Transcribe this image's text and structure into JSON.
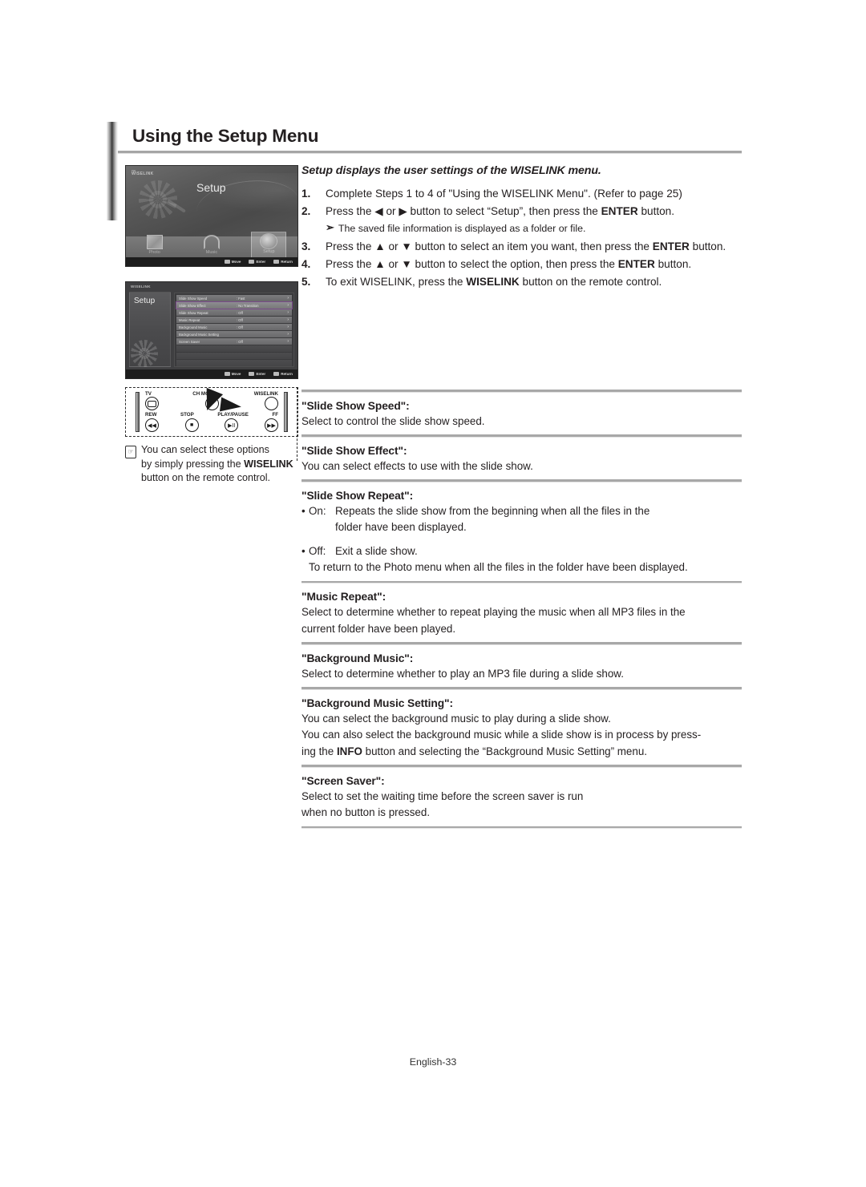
{
  "page": {
    "title": "Using the Setup Menu",
    "footer": "English-33"
  },
  "tv_screen_1": {
    "logo": "WISELINK",
    "logo_tm": "TM",
    "heading": "Setup",
    "icons": [
      {
        "label": "Photo",
        "selected": false
      },
      {
        "label": "Music",
        "selected": false
      },
      {
        "label": "Setup",
        "selected": true
      }
    ],
    "hints": [
      {
        "key": "◀▶",
        "label": "Move"
      },
      {
        "key": "ENTER",
        "label": "Enter"
      },
      {
        "key": "RETURN",
        "label": "Return"
      }
    ]
  },
  "tv_screen_2": {
    "logo": "WISELINK",
    "panel_title": "Setup",
    "rows": [
      {
        "name": "Slide Show Speed",
        "value": ": Fast",
        "highlight": false
      },
      {
        "name": "Slide Show Effect",
        "value": ": No Transition",
        "highlight": true
      },
      {
        "name": "Slide Show Repeat",
        "value": ": Off",
        "highlight": false
      },
      {
        "name": "Music Repeat",
        "value": ": Off",
        "highlight": false
      },
      {
        "name": "Background Music",
        "value": ": Off",
        "highlight": false
      },
      {
        "name": "Background Music Setting",
        "value": "",
        "highlight": false
      },
      {
        "name": "Screen Saver",
        "value": ": Off",
        "highlight": false
      }
    ],
    "hints": [
      {
        "key": "▲▼",
        "label": "Move"
      },
      {
        "key": "ENTER",
        "label": "Enter"
      },
      {
        "key": "RETURN",
        "label": "Return"
      }
    ]
  },
  "remote": {
    "labels_top": [
      "TV",
      "CH MGR",
      "WISELINK"
    ],
    "labels_mid": [
      "REW",
      "STOP",
      "PLAY/PAUSE",
      "FF"
    ],
    "buttons_bottom": [
      "◀◀",
      "■",
      "▶II",
      "▶▶"
    ],
    "note": {
      "icon": "note-hand-icon",
      "line1": "You can select these options",
      "line2_pre": "by simply pressing the ",
      "line2_bold": "WISELINK",
      "line3": "button on the remote control."
    }
  },
  "intro": "Setup displays the user settings of the WISELINK menu.",
  "steps": [
    {
      "num": "1.",
      "parts": [
        {
          "t": "Complete Steps 1 to 4 of \"Using the WISELINK Menu\". (Refer to page 25)",
          "b": false
        }
      ]
    },
    {
      "num": "2.",
      "parts": [
        {
          "t": "Press the ",
          "b": false
        },
        {
          "t": "◀",
          "b": false
        },
        {
          "t": " or ",
          "b": false
        },
        {
          "t": "▶",
          "b": false
        },
        {
          "t": " button to select “Setup”, then press the ",
          "b": false
        },
        {
          "t": "ENTER",
          "b": true
        },
        {
          "t": " button.",
          "b": false
        }
      ],
      "sub": {
        "arrow": "➢",
        "text": "The saved file information is displayed as a folder or file."
      }
    },
    {
      "num": "3.",
      "parts": [
        {
          "t": "Press the ",
          "b": false
        },
        {
          "t": "▲",
          "b": false
        },
        {
          "t": " or ",
          "b": false
        },
        {
          "t": "▼",
          "b": false
        },
        {
          "t": " button to select an item you want, then press the ",
          "b": false
        },
        {
          "t": "ENTER",
          "b": true
        },
        {
          "t": " button.",
          "b": false
        }
      ]
    },
    {
      "num": "4.",
      "parts": [
        {
          "t": "Press the ",
          "b": false
        },
        {
          "t": "▲",
          "b": false
        },
        {
          "t": " or ",
          "b": false
        },
        {
          "t": "▼",
          "b": false
        },
        {
          "t": " button to select the option, then press the ",
          "b": false
        },
        {
          "t": "ENTER",
          "b": true
        },
        {
          "t": " button.",
          "b": false
        }
      ]
    },
    {
      "num": "5.",
      "parts": [
        {
          "t": "To exit WISELINK, press the ",
          "b": false
        },
        {
          "t": "WISELINK",
          "b": true
        },
        {
          "t": " button on the remote control.",
          "b": false
        }
      ]
    }
  ],
  "definitions": {
    "slide_show_speed": {
      "term": "\"Slide Show Speed\":",
      "body": "Select to control the slide show speed."
    },
    "slide_show_effect": {
      "term": "\"Slide Show Effect\":",
      "body": "You can select effects to use with the slide show."
    },
    "slide_show_repeat": {
      "term": "\"Slide Show Repeat\":",
      "on_dot": "•",
      "on_key": "On:",
      "on_body": "Repeats the slide show from the beginning when all the files in the",
      "on_cont": "folder have been displayed.",
      "off_dot": "•",
      "off_key": "Off:",
      "off_body": "Exit a slide show.",
      "off_cont": "To return to the Photo menu when all the files in the folder have been displayed."
    },
    "music_repeat": {
      "term": "\"Music Repeat\":",
      "line1": "Select to determine whether to repeat playing the music when all MP3 files in the",
      "line2": "current folder have been played."
    },
    "background_music": {
      "term": "\"Background Music\":",
      "body": "Select to determine whether to play an MP3 file during a slide show."
    },
    "background_music_setting": {
      "term": "\"Background Music Setting\":",
      "line1": "You can select the background music to play during a slide show.",
      "line2": "You can also select the background music while a slide show is in process by press-",
      "line3_pre": "ing the ",
      "line3_bold": "INFO",
      "line3_post": " button and selecting the “Background Music Setting” menu."
    },
    "screen_saver": {
      "term": "\"Screen Saver\":",
      "line1": "Select to set the waiting time before the screen saver is run",
      "line2": "when no button is pressed."
    }
  }
}
